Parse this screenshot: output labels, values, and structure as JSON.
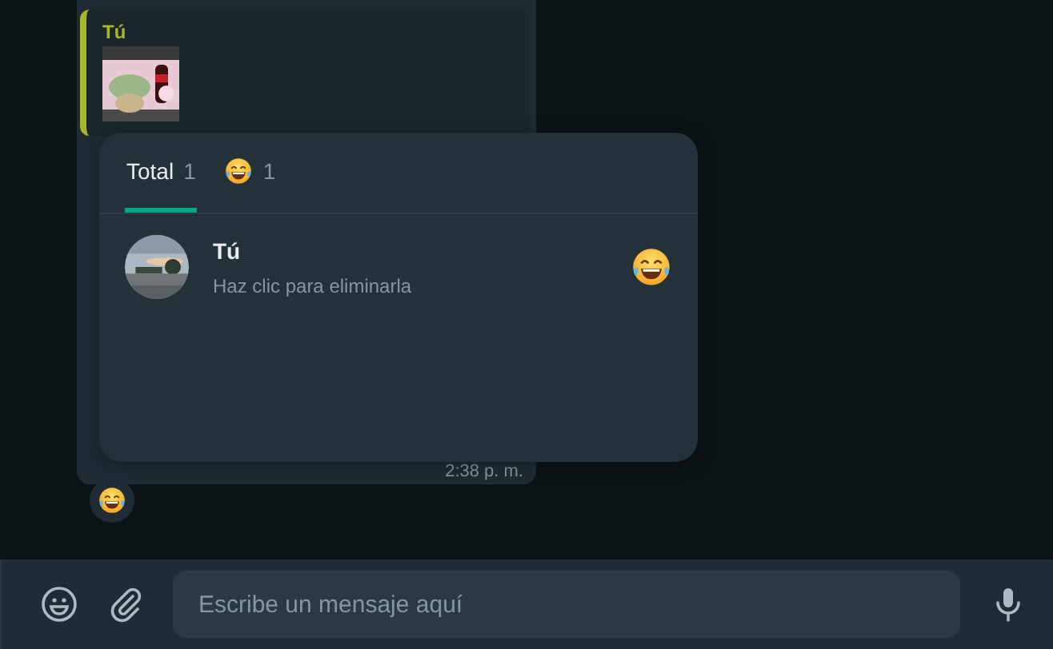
{
  "message": {
    "quote": {
      "author": "Tú"
    },
    "time": "2:38 p. m.",
    "reaction_badge": {
      "kind": "laugh"
    }
  },
  "reactions_popup": {
    "tabs": [
      {
        "label": "Total",
        "count": "1",
        "selected": true
      },
      {
        "kind": "emoji",
        "count": "1",
        "selected": false
      }
    ],
    "rows": [
      {
        "name": "Tú",
        "hint": "Haz clic para eliminarla"
      }
    ]
  },
  "composer": {
    "placeholder": "Escribe un mensaje aquí"
  }
}
